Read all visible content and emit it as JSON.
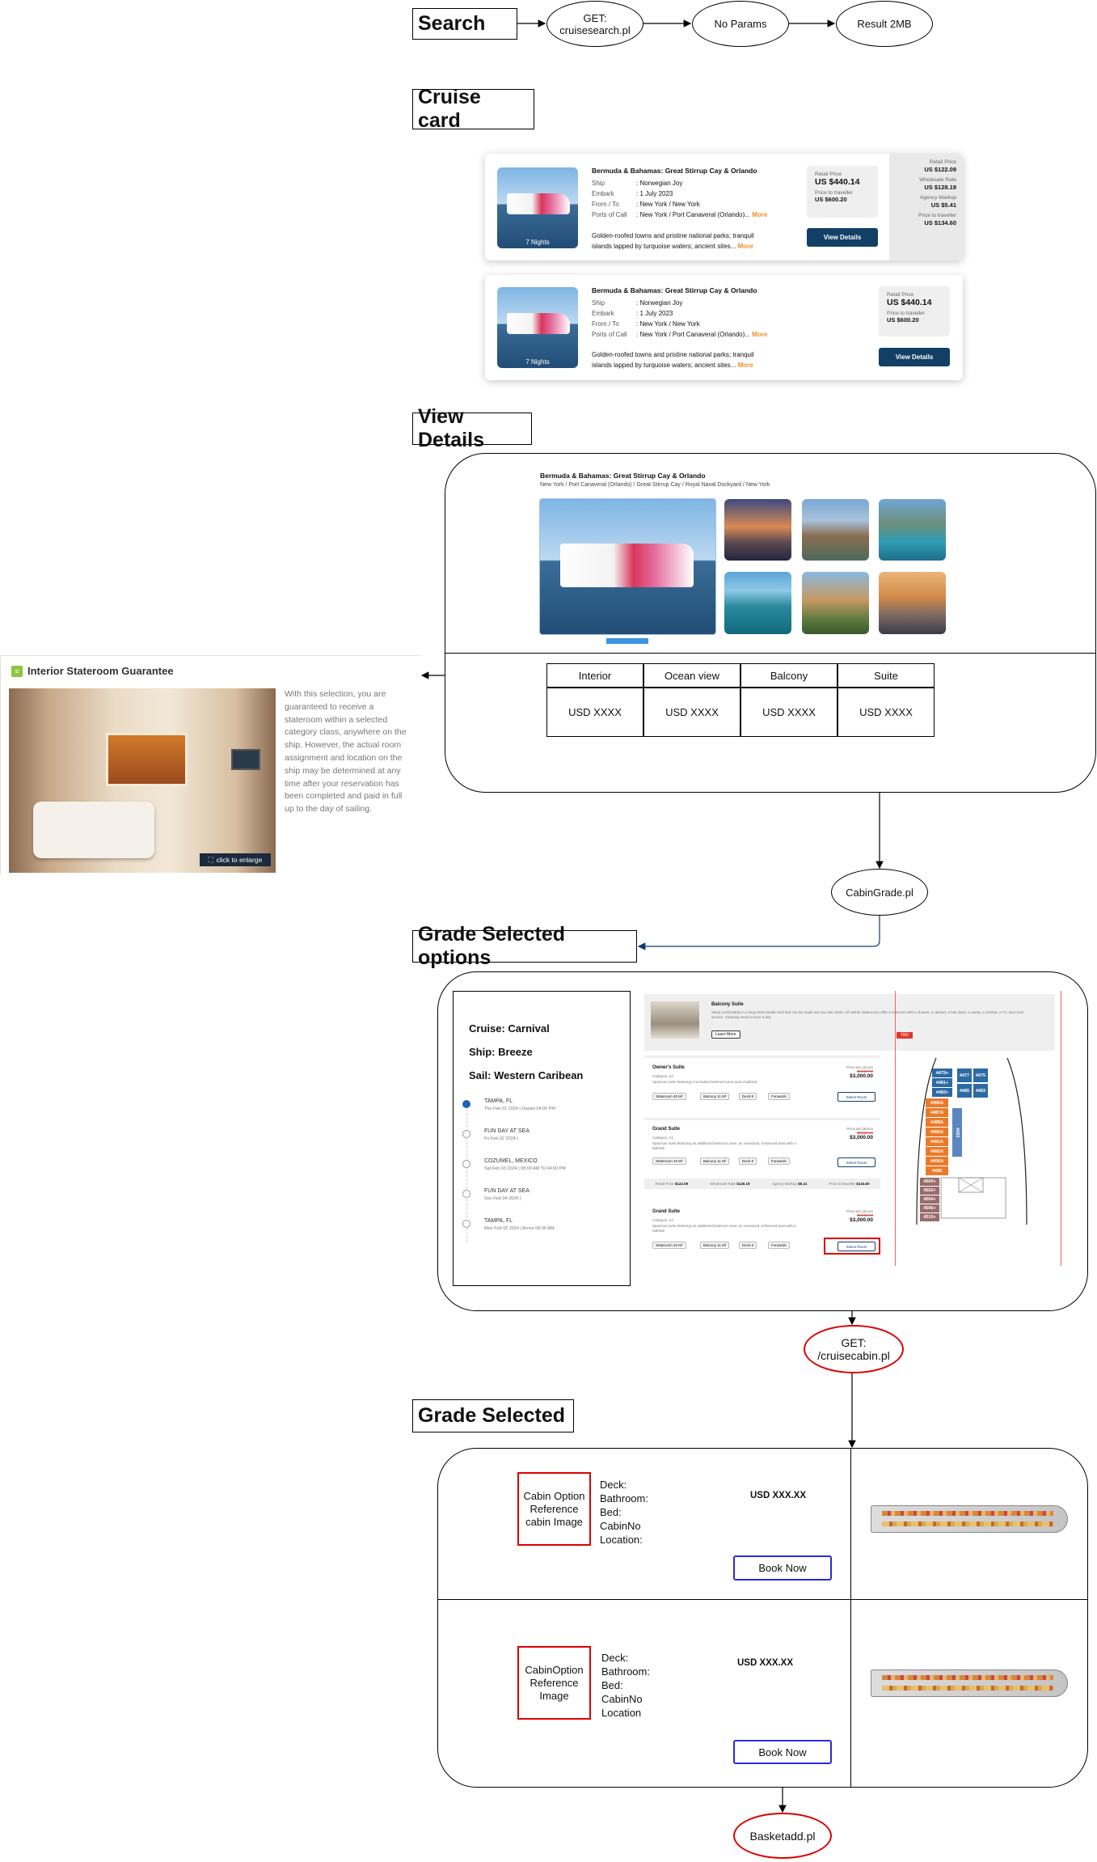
{
  "search": {
    "title": "Search",
    "get_node": "GET: cruisesearch.pl",
    "params_node": "No Params",
    "result_node": "Result 2MB"
  },
  "cruise_card": {
    "title": "Cruise card",
    "cards": [
      {
        "nights": "7 Nights",
        "name": "Bermuda & Bahamas: Great Stirrup Cay & Orlando",
        "ship_label": "Ship",
        "ship": ": Norwegian Joy",
        "embark_label": "Embark",
        "embark": ": 1 July 2023",
        "fromto_label": "From / To",
        "fromto": ": New York / New York",
        "ports_label": "Ports of Call",
        "ports": ": New York / Port Canaveral (Orlando)...",
        "ports_more": "More",
        "desc_1": "Golden-roofed towns and pristine national parks; tranquil",
        "desc_2": "islands lapped by turquoise waters; ancient sites...",
        "desc_more": "More",
        "retail_label": "Retail Price",
        "retail": "US $440.14",
        "traveller_label": "Price to traveller",
        "traveller": "US $600.20",
        "button": "View Details",
        "side": {
          "retail_label": "Retail Price",
          "retail": "US $122.09",
          "wholesale_label": "Wholesale Rate",
          "wholesale": "US $128.19",
          "markup_label": "Agency Markup",
          "markup": "US $5.41",
          "traveller_label": "Price to traveller",
          "traveller": "US $134.60"
        }
      },
      {
        "nights": "7 Nights",
        "name": "Bermuda & Bahamas: Great Stirrup Cay & Orlando",
        "ship_label": "Ship",
        "ship": ": Norwegian Joy",
        "embark_label": "Embark",
        "embark": ": 1 July 2023",
        "fromto_label": "From / To",
        "fromto": ": New York / New York",
        "ports_label": "Ports of Call",
        "ports": ": New York / Port Canaveral (Orlando)...",
        "ports_more": "More",
        "desc_1": "Golden-roofed towns and pristine national parks; tranquil",
        "desc_2": "islands lapped by turquoise waters; ancient sites...",
        "desc_more": "More",
        "retail_label": "Retail Price",
        "retail": "US $440.14",
        "traveller_label": "Price to traveller",
        "traveller": "US $600.20",
        "button": "View Details"
      }
    ]
  },
  "view_details": {
    "title": "View Details",
    "cruise_name": "Bermuda & Bahamas: Great Stirrup Cay & Orlando",
    "route": "New York / Port Canaveral (Orlando) / Great Stirrup Cay / Royal Naval Dockyard / New York",
    "tabs": [
      {
        "label": "Interior",
        "price": "USD XXXX"
      },
      {
        "label": "Ocean view",
        "price": "USD XXXX"
      },
      {
        "label": "Balcony",
        "price": "USD XXXX"
      },
      {
        "label": "Suite",
        "price": "USD XXXX"
      }
    ]
  },
  "stateroom": {
    "title": "Interior Stateroom Guarantee",
    "enlarge": "click to enlarge",
    "text": "With this selection, you are guaranteed to receive a stateroom within a selected category class, anywhere on the ship. However, the actual room assignment and location on the ship may be determined at any time after your reservation has been completed and paid in full up to the day of sailing."
  },
  "cabingrade_node": "CabinGrade.pl",
  "grade_options": {
    "title": "Grade Selected options",
    "cruise": "Cruise: Carnival",
    "ship": "Ship: Breeze",
    "sail": "Sail: Western Caribean",
    "itinerary": [
      {
        "port": "TAMPA, FL",
        "info": "Thu Feb 01 2024 | Depart 04:00 PM"
      },
      {
        "port": "FUN DAY AT SEA",
        "info": "Fri Feb 02 2024 |"
      },
      {
        "port": "COZUMEL, MEXICO",
        "info": "Sat Feb 03 2024 | 08:00 AM To 04:00 PM"
      },
      {
        "port": "FUN DAY AT SEA",
        "info": "Sun Feb 04 2024 |"
      },
      {
        "port": "TAMPA, FL",
        "info": "Mon Feb 05 2024 | Arrive 08:00 AM"
      }
    ],
    "header_name": "Balcony Suite",
    "header_desc": "Sleep comfortably in a king-sized double bed that can be made into two twin beds. All Visible staterooms offer a restroom with a shower, a cabinet, a hair dryer, a vanity, a minibar, a TV, and room service. Cleaning service twice a day.",
    "learn_more": "Learn More",
    "badge": "TBD",
    "options": [
      {
        "name": "Owner's Suite",
        "category": "Category: S1",
        "desc": "Spacious suite featuring a secluded bedroom area and a bathtub",
        "chips": [
          "Stateroom 40 M²",
          "Balcony 11 M²",
          "Deck 8",
          "Forwards"
        ],
        "price_label": "Price per person",
        "old": "$3,520.00",
        "price": "$3,000.00",
        "button": "Select Room"
      },
      {
        "name": "Grand Suite",
        "category": "Category: X1",
        "desc": "Spacious suite featuring an additional bedroom area, an oversized, enhanced area with a bathtub",
        "chips": [
          "Stateroom 40 M²",
          "Balcony 11 M²",
          "Deck 8",
          "Forwards"
        ],
        "price_label": "Price per person",
        "old": "$3,520.00",
        "price": "$3,000.00",
        "button": "Select Room"
      },
      {
        "name": "Grand Suite",
        "category": "Category: X1",
        "desc": "Spacious suite featuring an additional bedroom area, an oversized, enhanced area with a bathtub",
        "chips": [
          "Stateroom 40 M²",
          "Balcony 11 M²",
          "Deck 8",
          "Forwards"
        ],
        "price_label": "Price per person",
        "old": "$3,520.00",
        "price": "$3,000.00",
        "button": "Select Room"
      }
    ],
    "rates_row": {
      "retail_label": "Retail Price",
      "retail": "$122.09",
      "wholesale_label": "Wholesale Rate",
      "wholesale": "$128.19",
      "markup_label": "Agency Markup",
      "markup": "$5.41",
      "traveller_label": "Price to traveller",
      "traveller": "$134.60"
    },
    "deck_cells": [
      "4479+",
      "4481+",
      "4482+",
      "4477",
      "4475",
      "4483",
      "4485",
      "4486A",
      "4487A",
      "4488A",
      "4490A",
      "4491A",
      "4492A",
      "4493",
      "4496A",
      "4498",
      "4500+",
      "4502+",
      "4504+",
      "4506+",
      "4510+"
    ]
  },
  "cruisecabin_node": "GET: /cruisecabin.pl",
  "grade_selected": {
    "title": "Grade Selected",
    "rows": [
      {
        "image": "Cabin Option Reference cabin Image",
        "info": [
          "Deck:",
          "Bathroom:",
          "Bed:",
          "CabinNo",
          "Location:"
        ],
        "price": "USD XXX.XX",
        "button": "Book Now"
      },
      {
        "image": "CabinOption Reference Image",
        "info": [
          "Deck:",
          "Bathroom:",
          "Bed:",
          "CabinNo",
          "Location"
        ],
        "price": "USD XXX.XX",
        "button": "Book Now"
      }
    ]
  },
  "basket_node": "Basketadd.pl"
}
